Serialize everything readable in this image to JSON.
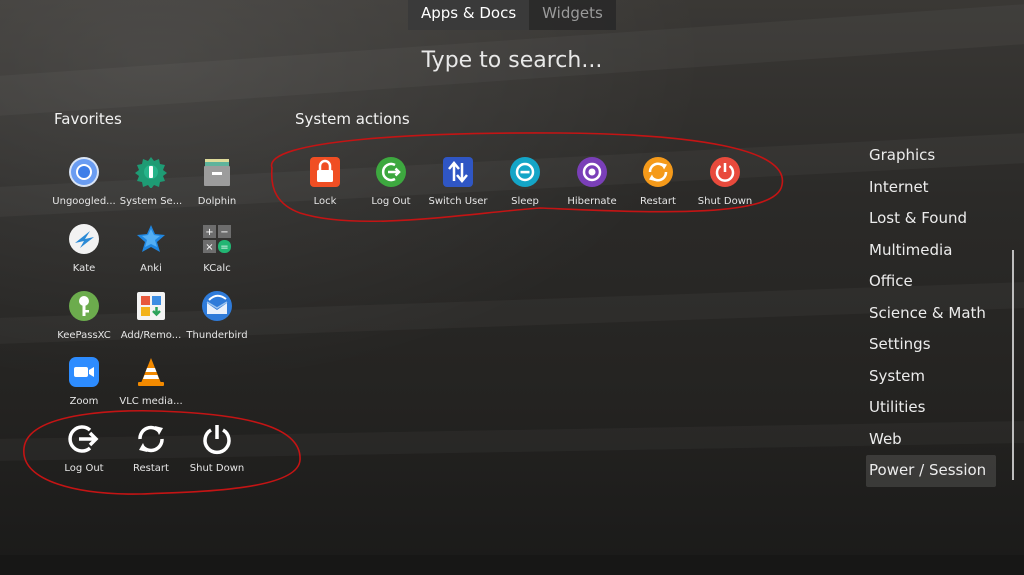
{
  "tabs": {
    "apps_docs": "Apps & Docs",
    "widgets": "Widgets"
  },
  "search": {
    "placeholder": "Type to search..."
  },
  "favorites": {
    "title": "Favorites",
    "items": [
      {
        "label": "Ungoogled...",
        "icon": "chromium-icon"
      },
      {
        "label": "System Se...",
        "icon": "system-settings-icon"
      },
      {
        "label": "Dolphin",
        "icon": "dolphin-icon"
      },
      {
        "label": "Kate",
        "icon": "kate-icon"
      },
      {
        "label": "Anki",
        "icon": "anki-icon"
      },
      {
        "label": "KCalc",
        "icon": "kcalc-icon"
      },
      {
        "label": "KeePassXC",
        "icon": "keepassxc-icon"
      },
      {
        "label": "Add/Remo...",
        "icon": "discover-icon"
      },
      {
        "label": "Thunderbird",
        "icon": "thunderbird-icon"
      },
      {
        "label": "Zoom",
        "icon": "zoom-icon"
      },
      {
        "label": "VLC media...",
        "icon": "vlc-icon"
      },
      {
        "label": "Log Out",
        "icon": "logout-icon"
      },
      {
        "label": "Restart",
        "icon": "restart-icon"
      },
      {
        "label": "Shut Down",
        "icon": "power-icon"
      }
    ]
  },
  "system_actions": {
    "title": "System actions",
    "items": [
      {
        "label": "Lock",
        "icon": "lock-icon",
        "color": "#f04e23"
      },
      {
        "label": "Log Out",
        "icon": "logout-icon",
        "color": "#3da83f"
      },
      {
        "label": "Switch User",
        "icon": "switch-user-icon",
        "color": "#2f56c4"
      },
      {
        "label": "Sleep",
        "icon": "sleep-icon",
        "color": "#14a5c7"
      },
      {
        "label": "Hibernate",
        "icon": "hibernate-icon",
        "color": "#7a3fb8"
      },
      {
        "label": "Restart",
        "icon": "restart-icon",
        "color": "#f59a1a"
      },
      {
        "label": "Shut Down",
        "icon": "power-icon",
        "color": "#e84a3c"
      }
    ]
  },
  "categories": {
    "items": [
      "Graphics",
      "Internet",
      "Lost & Found",
      "Multimedia",
      "Office",
      "Science & Math",
      "Settings",
      "System",
      "Utilities",
      "Web",
      "Power / Session"
    ],
    "selected": "Power / Session"
  },
  "annotation_color": "#c41414"
}
